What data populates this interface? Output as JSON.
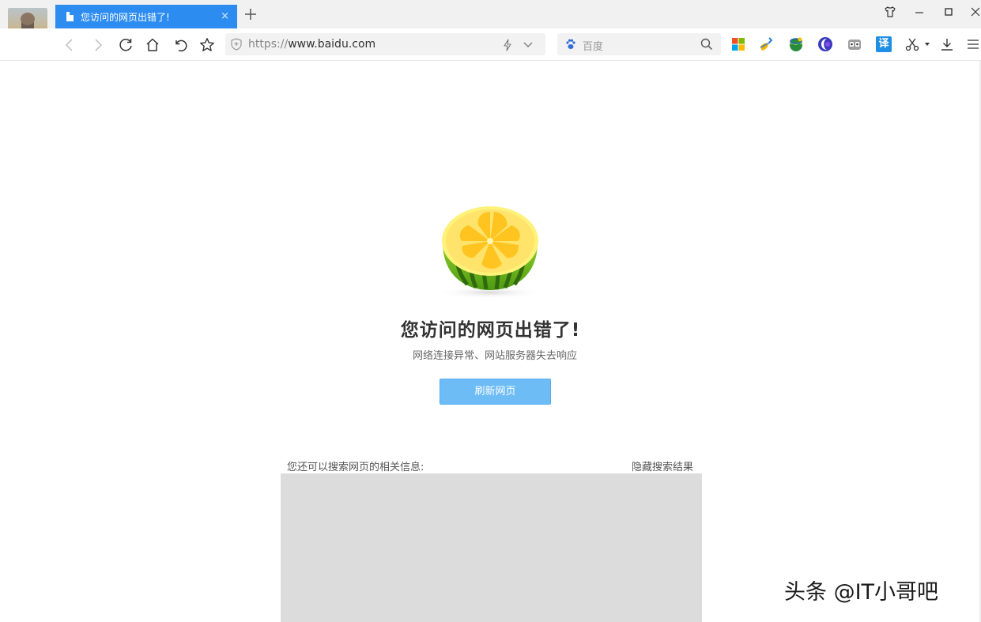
{
  "tab": {
    "title": "您访问的网页出错了!",
    "close": "×"
  },
  "toolbar": {
    "url_scheme": "https://",
    "url_host": "www.baidu.com",
    "search_placeholder": "百度"
  },
  "extensions": {
    "translate_label": "译"
  },
  "error": {
    "title": "您访问的网页出错了!",
    "subtitle": "网络连接异常、网站服务器失去响应",
    "refresh_label": "刷新网页"
  },
  "related": {
    "label": "您还可以搜索网页的相关信息:",
    "hide_label": "隐藏搜索结果"
  },
  "watermark": "头条 @IT小哥吧",
  "colors": {
    "tab_active": "#2d8cf0",
    "refresh_button": "#6dbcf6",
    "results_box": "#dcdcdc"
  }
}
